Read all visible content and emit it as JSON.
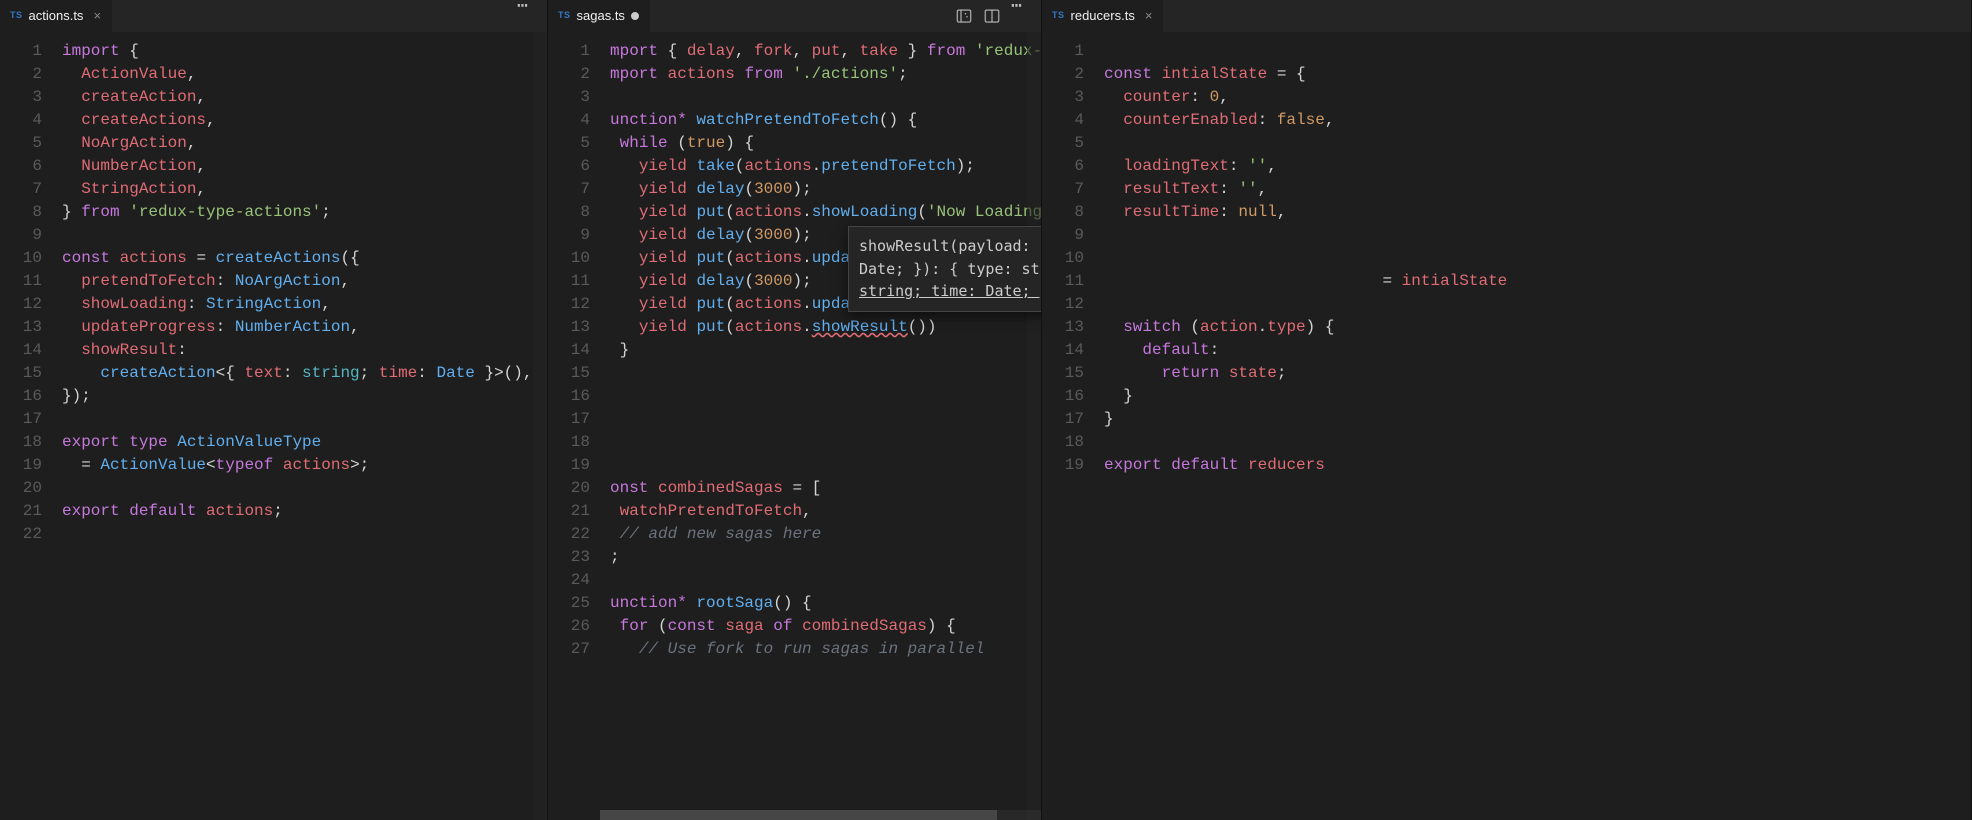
{
  "panes": {
    "left": {
      "tab": {
        "lang": "TS",
        "name": "actions.ts",
        "modified": false
      },
      "lineCount": 22,
      "code": {
        "l1": "<span class=kw>import</span> {",
        "l2": "  <span class=id>ActionValue</span>,",
        "l3": "  <span class=id>createAction</span>,",
        "l4": "  <span class=id>createActions</span>,",
        "l5": "  <span class=id>NoArgAction</span>,",
        "l6": "  <span class=id>NumberAction</span>,",
        "l7": "  <span class=id>StringAction</span>,",
        "l8": "} <span class=kw>from</span> <span class=str>'redux-type-actions'</span>;",
        "l9": "",
        "l10": "<span class=kw>const</span> <span class=id>actions</span> = <span class=fn>createActions</span>({",
        "l11": "  <span class=id>pretendToFetch</span>: <span class=fn>NoArgAction</span>,",
        "l12": "  <span class=id>showLoading</span>: <span class=fn>StringAction</span>,",
        "l13": "  <span class=id>updateProgress</span>: <span class=fn>NumberAction</span>,",
        "l14": "  <span class=id>showResult</span>:",
        "l15": "    <span class=fn>createAction</span>&lt;{ <span class=id>text</span>: <span class=typ>string</span>; <span class=id>time</span>: <span class=fn>Date</span> }&gt;(),",
        "l16": "});",
        "l17": "",
        "l18": "<span class=kw>export</span> <span class=kw>type</span> <span class=fn>ActionValueType</span>",
        "l19": "  = <span class=fn>ActionValue</span>&lt;<span class=kw>typeof</span> <span class=id>actions</span>&gt;;",
        "l20": "",
        "l21": "<span class=kw>export</span> <span class=kw>default</span> <span class=id>actions</span>;",
        "l22": ""
      }
    },
    "mid": {
      "tab": {
        "lang": "TS",
        "name": "sagas.ts",
        "modified": true
      },
      "lineCount": 27,
      "code": {
        "l1": "<span class=kw>mport</span> { <span class=id>delay</span>, <span class=id>fork</span>, <span class=id>put</span>, <span class=id>take</span> } <span class=kw>from</span> <span class=str>'redux-s</span>",
        "l2": "<span class=kw>mport</span> <span class=id>actions</span> <span class=kw>from</span> <span class=str>'./actions'</span>;",
        "l3": "",
        "l4": "<span class=kw>unction*</span> <span class=fn>watchPretendToFetch</span>() {",
        "l5": " <span class=kw>while</span> (<span class=bool>true</span>) {",
        "l6": "   <span class=yld>yield</span> <span class=fn>take</span>(<span class=id>actions</span>.<span class=fn>pretendToFetch</span>);",
        "l7": "   <span class=yld>yield</span> <span class=fn>delay</span>(<span class=num>3000</span>);",
        "l8": "   <span class=yld>yield</span> <span class=fn>put</span>(<span class=id>actions</span>.<span class=fn>showLoading</span>(<span class=str>'Now Loading</span><span class=cursor></span>",
        "l9": "   <span class=yld>yield</span> <span class=fn>delay</span>(<span class=num>3000</span>);",
        "l10": "   <span class=yld>yield</span> <span class=fn>put</span>(<span class=id>actions</span>.<span class=fn>updateProgr</span>",
        "l11": "   <span class=yld>yield</span> <span class=fn>delay</span>(<span class=num>3000</span>);",
        "l12": "   <span class=yld>yield</span> <span class=fn>put</span>(<span class=id>actions</span>.<span class=fn>updateProgr</span>",
        "l13": "   <span class=yld>yield</span> <span class=fn>put</span>(<span class=id>actions</span>.<span class='fn badcall'>showResult</span>())",
        "l14": " }",
        "l15": "",
        "l16": "",
        "l17": "",
        "l18": "",
        "l19": "",
        "l20": "<span class=kw>onst</span> <span class=id>combinedSagas</span> = [",
        "l21": " <span class=id>watchPretendToFetch</span>,",
        "l22": " <span class=cm>// add new sagas here</span>",
        "l23": ";",
        "l24": "",
        "l25": "<span class=kw>unction*</span> <span class=fn>rootSaga</span>() {",
        "l26": " <span class=kw>for</span> (<span class=kw>const</span> <span class=id>saga</span> <span class=kw>of</span> <span class=id>combinedSagas</span>) {",
        "l27": "   <span class=cm>// Use fork to run sagas in parallel</span>"
      },
      "hover": "showResult(payload: { text: string; time: Date; }): { type: string; <u>payload: { text: string; time: Date; }</u>; }"
    },
    "right": {
      "tab": {
        "lang": "TS",
        "name": "reducers.ts",
        "modified": false
      },
      "lineCount": 19,
      "code": {
        "l1": "",
        "l2": "<span class=kw>const</span> <span class=id>intialState</span> = {",
        "l3": "  <span class=id>counter</span>: <span class=num>0</span>,",
        "l4": "  <span class=id>counterEnabled</span>: <span class=bool>false</span>,",
        "l5": "",
        "l6": "  <span class=id>loadingText</span>: <span class=str>''</span>,",
        "l7": "  <span class=id>resultText</span>: <span class=str>''</span>,",
        "l8": "  <span class=id>resultTime</span>: <span class=bool>null</span>,",
        "l9": "",
        "l10": "",
        "l11": "                             = <span class=id>intialState</span>",
        "l12": "",
        "l13": "  <span class=kw>switch</span> (<span class=id>action</span>.<span class=id>type</span>) {",
        "l14": "    <span class=kw>default</span>:",
        "l15": "      <span class=kw>return</span> <span class=id>state</span>;",
        "l16": "  }",
        "l17": "}",
        "l18": "",
        "l19": "<span class=kw>export</span> <span class=kw>default</span> <span class=id>reducers</span>"
      }
    }
  },
  "icons": {
    "splitHoriz": "split-horizontal-icon",
    "preview": "preview-icon",
    "more": "more-icon"
  }
}
